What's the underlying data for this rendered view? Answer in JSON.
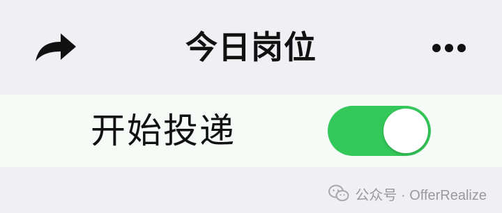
{
  "nav": {
    "title": "今日岗位",
    "share_icon": "share-arrow-icon",
    "more_icon": "more-dots-icon"
  },
  "settings": {
    "start_delivery_label": "开始投递",
    "start_delivery_enabled": true
  },
  "watermark": {
    "text": "公众号 · OfferRealize",
    "icon": "wechat-icon"
  },
  "colors": {
    "background": "#efeff4",
    "toggle_on": "#34c759",
    "text": "#111111"
  }
}
